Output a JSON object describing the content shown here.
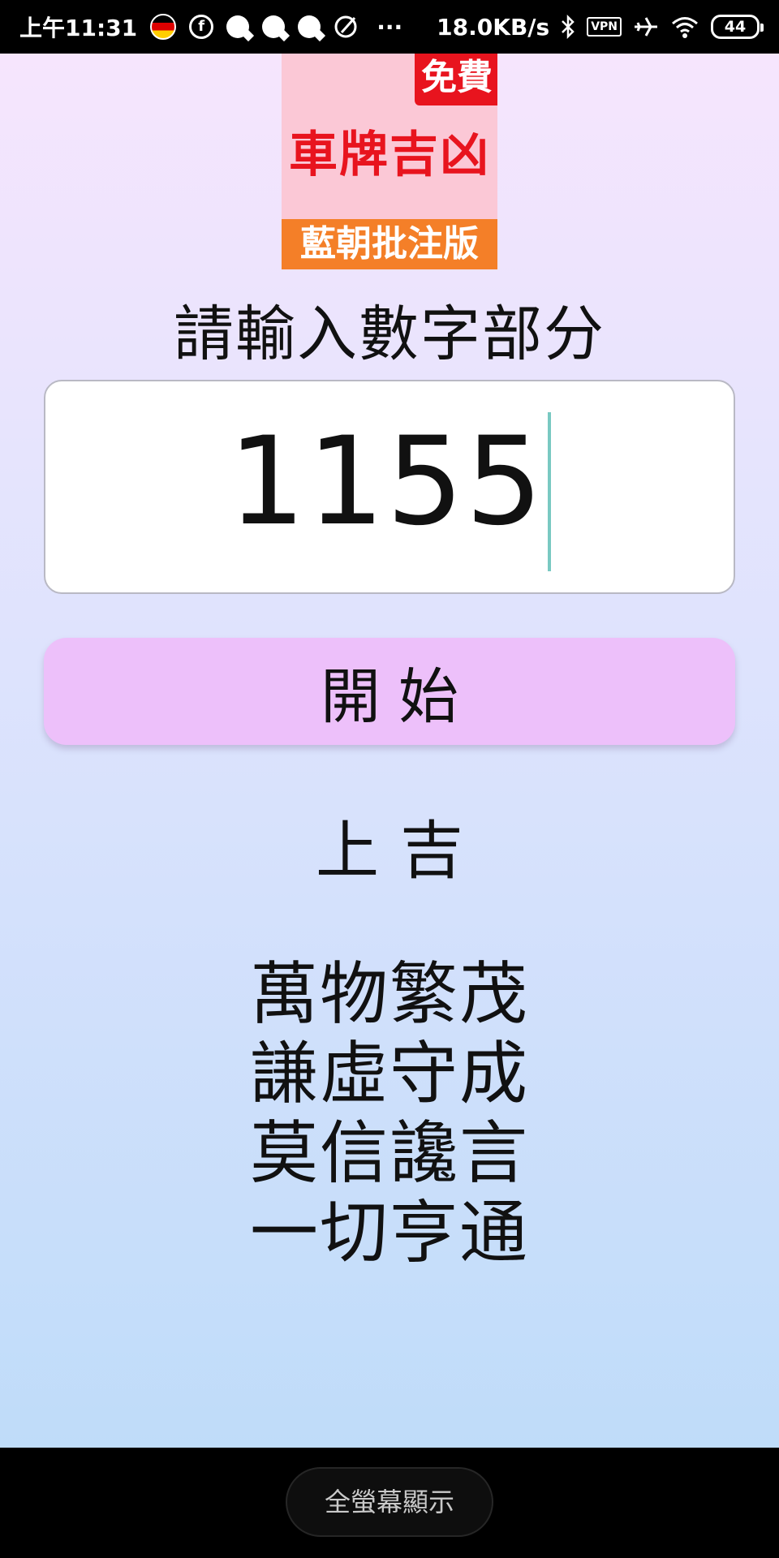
{
  "status_bar": {
    "time": "上午11:31",
    "net_speed": "18.0KB/s",
    "vpn_label": "VPN",
    "battery": "44",
    "dots": "···"
  },
  "logo": {
    "badge": "免費",
    "title": "車牌吉凶",
    "subtitle": "藍朝批注版"
  },
  "prompt": "請輸入數字部分",
  "input": {
    "value": "1155"
  },
  "start_button": "開始",
  "result": {
    "level": "上吉",
    "verse_lines": [
      "萬物繁茂",
      "謙虛守成",
      "莫信讒言",
      "一切亨通"
    ]
  },
  "nav": {
    "fullscreen_label": "全螢幕顯示"
  }
}
